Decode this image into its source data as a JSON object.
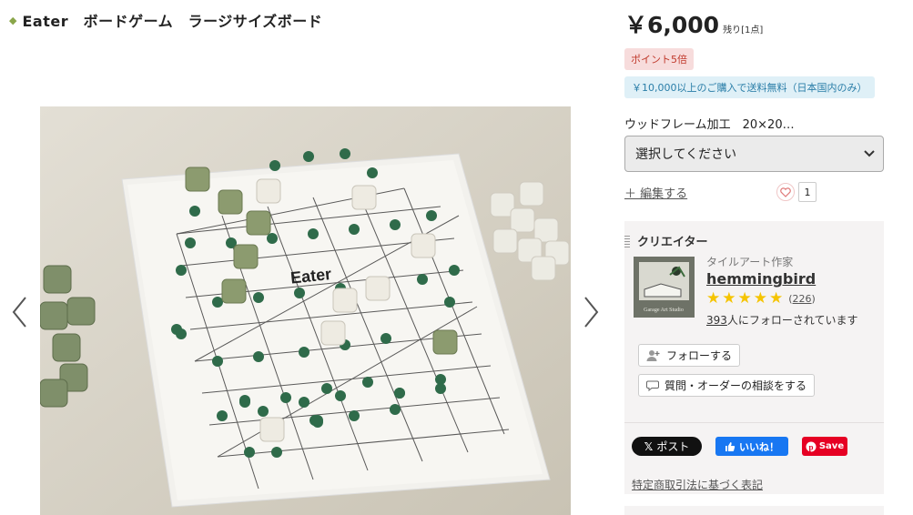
{
  "product": {
    "title_icon": "leaf-icon",
    "title": "Eater　ボードゲーム　ラージサイズボード",
    "price": "￥6,000",
    "stock": "残り[1点]",
    "points_badge": "ポイント5倍",
    "shipping_badge": "￥10,000以上のご購入で送料無料（日本国内のみ）",
    "option_label": "ウッドフレーム加工　20×20…",
    "option_placeholder": "選択してください",
    "edit_label": "＋ 編集する",
    "favorite_count": "1"
  },
  "gallery": {
    "board_logo": "Eater",
    "prev_icon": "chevron-left-icon",
    "next_icon": "chevron-right-icon"
  },
  "creator": {
    "heading": "クリエイター",
    "avatar_text": "Garage Art Studio",
    "role": "タイルアート作家",
    "name": "hemmingbird",
    "rating": 5,
    "reviews": "226",
    "followers": "393",
    "followers_suffix": "人にフォローされています",
    "follow_button": "フォローする",
    "ask_button": "質問・オーダーの相談をする"
  },
  "share": {
    "x_label": "ポスト",
    "fb_label": "いいね！",
    "pin_label": "Save"
  },
  "footer": {
    "law_link": "特定商取引法に基づく表記"
  },
  "colors": {
    "points_bg": "#f7dcdc",
    "points_text": "#c0392b",
    "ship_bg": "#dff0f7",
    "ship_text": "#2a7ea8",
    "star": "#f5c400",
    "facebook": "#1877f2",
    "pinterest": "#e60023"
  }
}
